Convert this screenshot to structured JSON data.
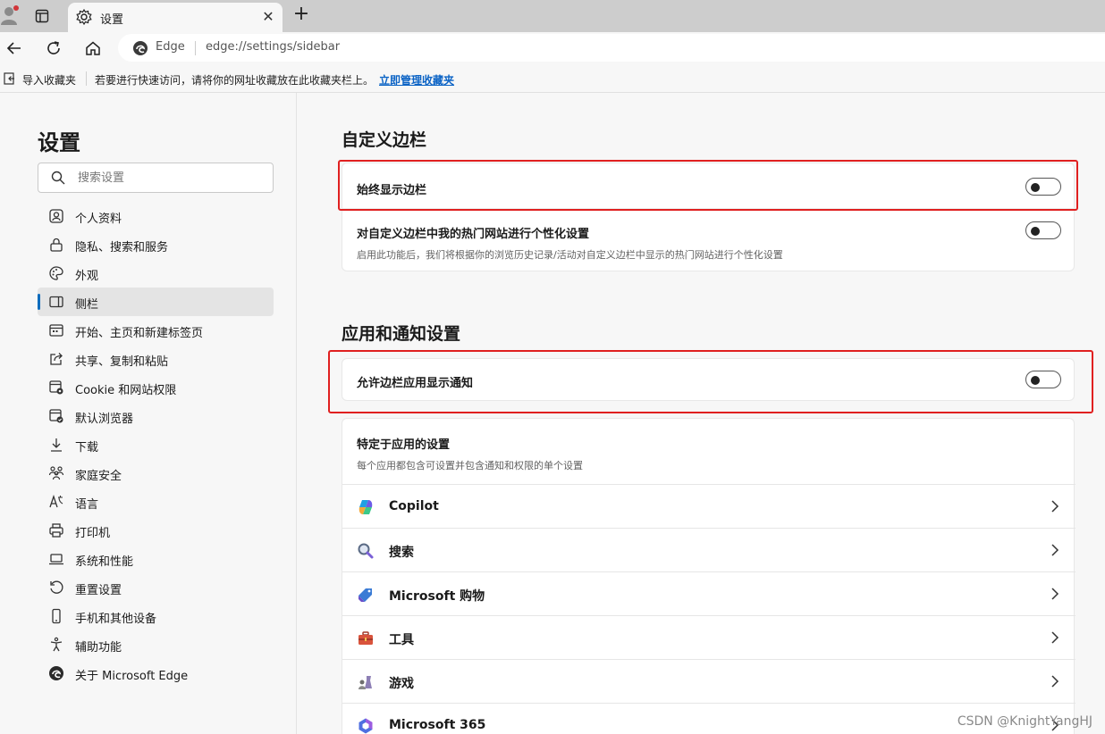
{
  "browser": {
    "tab_title": "设置",
    "new_tab_symbol": "+",
    "close_symbol": "✕",
    "omnibox_site": "Edge",
    "url": "edge://settings/sidebar"
  },
  "favorites_bar": {
    "import_label": "导入收藏夹",
    "hint": "若要进行快速访问，请将你的网址收藏放在此收藏夹栏上。",
    "manage_link": "立即管理收藏夹"
  },
  "settings_nav": {
    "title": "设置",
    "search_placeholder": "搜索设置",
    "items": [
      {
        "label": "个人资料",
        "icon": "profile-icon"
      },
      {
        "label": "隐私、搜索和服务",
        "icon": "lock-icon"
      },
      {
        "label": "外观",
        "icon": "palette-icon"
      },
      {
        "label": "侧栏",
        "icon": "sidebar-icon",
        "active": true
      },
      {
        "label": "开始、主页和新建标签页",
        "icon": "home-page-icon"
      },
      {
        "label": "共享、复制和粘贴",
        "icon": "share-icon"
      },
      {
        "label": "Cookie 和网站权限",
        "icon": "cookie-icon"
      },
      {
        "label": "默认浏览器",
        "icon": "browser-icon"
      },
      {
        "label": "下载",
        "icon": "download-icon"
      },
      {
        "label": "家庭安全",
        "icon": "family-icon"
      },
      {
        "label": "语言",
        "icon": "language-icon"
      },
      {
        "label": "打印机",
        "icon": "printer-icon"
      },
      {
        "label": "系统和性能",
        "icon": "laptop-icon"
      },
      {
        "label": "重置设置",
        "icon": "reset-icon"
      },
      {
        "label": "手机和其他设备",
        "icon": "phone-icon"
      },
      {
        "label": "辅助功能",
        "icon": "accessibility-icon"
      },
      {
        "label": "关于 Microsoft Edge",
        "icon": "edge-icon"
      }
    ]
  },
  "customize_section": {
    "title": "自定义边栏",
    "always_show": {
      "label": "始终显示边栏",
      "enabled": false
    },
    "personalize": {
      "label": "对自定义边栏中我的热门网站进行个性化设置",
      "description": "启用此功能后，我们将根据你的浏览历史记录/活动对自定义边栏中显示的热门网站进行个性化设置",
      "enabled": false
    }
  },
  "apps_section": {
    "title": "应用和通知设置",
    "allow_notifications": {
      "label": "允许边栏应用显示通知",
      "enabled": false
    },
    "app_specific": {
      "title": "特定于应用的设置",
      "description": "每个应用都包含可设置并包含通知和权限的单个设置"
    },
    "apps": [
      {
        "label": "Copilot",
        "icon": "copilot-icon"
      },
      {
        "label": "搜索",
        "icon": "search-app-icon"
      },
      {
        "label": "Microsoft 购物",
        "icon": "shopping-tag-icon"
      },
      {
        "label": "工具",
        "icon": "toolbox-icon"
      },
      {
        "label": "游戏",
        "icon": "games-icon"
      },
      {
        "label": "Microsoft 365",
        "icon": "m365-icon"
      }
    ]
  },
  "watermark": "CSDN @KnightYangHJ",
  "colors": {
    "accent": "#0f6cbd",
    "highlight_box": "#e02020",
    "link": "#0b63c5"
  }
}
